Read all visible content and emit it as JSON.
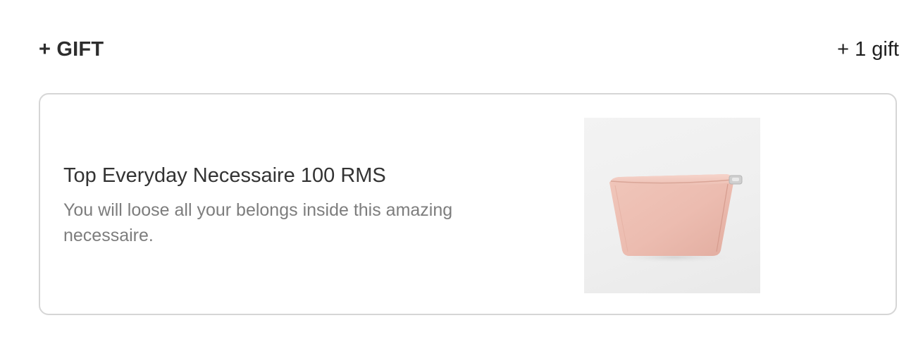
{
  "header": {
    "title": "+ GIFT",
    "count": "+ 1 gift"
  },
  "gift": {
    "name": "Top Everyday Necessaire 100 RMS",
    "description": "You will loose all your belongs inside this amazing necessaire.",
    "image_icon": "pink-pouch-icon",
    "colors": {
      "pouch": "#efc2b6",
      "background": "#efefef"
    }
  }
}
